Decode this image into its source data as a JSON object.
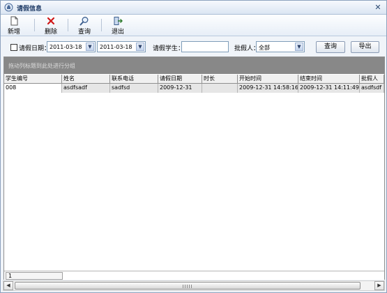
{
  "window": {
    "title": "请假信息",
    "close_glyph": "✕"
  },
  "toolbar": {
    "items": [
      {
        "label": "新增",
        "icon": "new-document-icon"
      },
      {
        "label": "删除",
        "icon": "delete-x-icon"
      },
      {
        "label": "查询",
        "icon": "search-icon"
      },
      {
        "label": "退出",
        "icon": "exit-icon"
      }
    ]
  },
  "filter": {
    "leave_date_label": "请假日期：",
    "date_from": "2011-03-18",
    "date_to": "2011-03-18",
    "student_label": "请假学生：",
    "student_value": "",
    "approver_label": "批假人：",
    "approver_value": "全部",
    "query_button": "查询",
    "export_button": "导出"
  },
  "grid": {
    "group_hint": "拖动列标题到此处进行分组",
    "columns": [
      "学生编号",
      "姓名",
      "联系电话",
      "请假日期",
      "时长",
      "开始时间",
      "结束时间",
      "批假人"
    ],
    "rows": [
      [
        "008",
        "asdfsadf",
        "sadfsd",
        "2009-12-31",
        "",
        "2009-12-31 14:58:16",
        "2009-12-31 14:11:49",
        "asdfsdf"
      ]
    ],
    "page_indicator": "1"
  },
  "colors": {
    "group_panel": "#888888",
    "row_fill": "#e6e6e6",
    "window_bg": "#f0f4f9"
  }
}
